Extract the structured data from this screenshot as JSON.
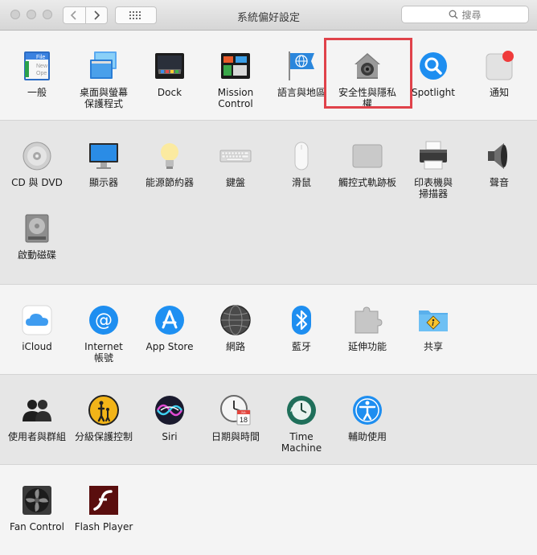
{
  "window": {
    "title": "系統偏好設定"
  },
  "search": {
    "placeholder": "搜尋"
  },
  "sections": [
    {
      "items": [
        {
          "label": "一般",
          "icon": "general-icon"
        },
        {
          "label": "桌面與螢幕\n保護程式",
          "icon": "desktop-screensaver-icon"
        },
        {
          "label": "Dock",
          "icon": "dock-icon"
        },
        {
          "label": "Mission\nControl",
          "icon": "mission-control-icon"
        },
        {
          "label": "語言與地區",
          "icon": "language-region-icon"
        },
        {
          "label": "安全性與隱私權",
          "icon": "security-privacy-icon"
        },
        {
          "label": "Spotlight",
          "icon": "spotlight-icon"
        },
        {
          "label": "通知",
          "icon": "notifications-icon"
        }
      ]
    },
    {
      "items": [
        {
          "label": "CD 與 DVD",
          "icon": "cd-dvd-icon"
        },
        {
          "label": "顯示器",
          "icon": "displays-icon"
        },
        {
          "label": "能源節約器",
          "icon": "energy-saver-icon"
        },
        {
          "label": "鍵盤",
          "icon": "keyboard-icon"
        },
        {
          "label": "滑鼠",
          "icon": "mouse-icon"
        },
        {
          "label": "觸控式軌跡板",
          "icon": "trackpad-icon"
        },
        {
          "label": "印表機與\n掃描器",
          "icon": "printer-scanner-icon"
        },
        {
          "label": "聲音",
          "icon": "sound-icon"
        },
        {
          "label": "啟動磁碟",
          "icon": "startup-disk-icon"
        }
      ]
    },
    {
      "items": [
        {
          "label": "iCloud",
          "icon": "icloud-icon"
        },
        {
          "label": "Internet\n帳號",
          "icon": "internet-accounts-icon"
        },
        {
          "label": "App Store",
          "icon": "app-store-icon"
        },
        {
          "label": "網路",
          "icon": "network-icon"
        },
        {
          "label": "藍牙",
          "icon": "bluetooth-icon"
        },
        {
          "label": "延伸功能",
          "icon": "extensions-icon"
        },
        {
          "label": "共享",
          "icon": "sharing-icon"
        }
      ]
    },
    {
      "items": [
        {
          "label": "使用者與群組",
          "icon": "users-groups-icon"
        },
        {
          "label": "分級保護控制",
          "icon": "parental-controls-icon"
        },
        {
          "label": "Siri",
          "icon": "siri-icon"
        },
        {
          "label": "日期與時間",
          "icon": "date-time-icon"
        },
        {
          "label": "Time Machine",
          "icon": "time-machine-icon"
        },
        {
          "label": "輔助使用",
          "icon": "accessibility-icon"
        }
      ]
    },
    {
      "items": [
        {
          "label": "Fan Control",
          "icon": "fan-control-icon"
        },
        {
          "label": "Flash Player",
          "icon": "flash-player-icon"
        }
      ]
    }
  ],
  "icon_text": {
    "general_file": "File",
    "general_new": "New",
    "general_open": "Ope",
    "calendar_month": "JUL",
    "calendar_day": "18"
  },
  "colors": {
    "highlight": "#e0424a",
    "accent_blue": "#1e8ef0"
  }
}
